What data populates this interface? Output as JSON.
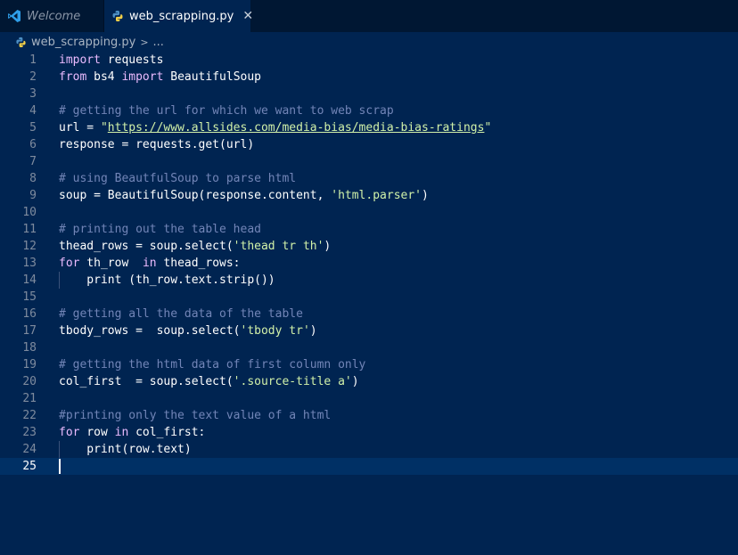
{
  "tabs": [
    {
      "label": "Welcome",
      "icon": "vscode-icon",
      "active": false
    },
    {
      "label": "web_scrapping.py",
      "icon": "python-icon",
      "active": true,
      "close": "✕"
    }
  ],
  "breadcrumb": {
    "file": "web_scrapping.py",
    "separator": ">",
    "more": "..."
  },
  "colors": {
    "editor_bg": "#002451",
    "tab_bar_bg": "#001733",
    "keyword": "#ebbbff",
    "comment": "#7285b7",
    "string": "#d1f1a9",
    "line_highlight": "#003065"
  },
  "editor": {
    "current_line": 25,
    "lines": [
      {
        "num": "1",
        "tokens": [
          {
            "t": "kw",
            "v": "import"
          },
          {
            "t": "id",
            "v": " requests"
          }
        ]
      },
      {
        "num": "2",
        "tokens": [
          {
            "t": "kw",
            "v": "from"
          },
          {
            "t": "id",
            "v": " bs4 "
          },
          {
            "t": "kw",
            "v": "import"
          },
          {
            "t": "id",
            "v": " BeautifulSoup"
          }
        ]
      },
      {
        "num": "3",
        "tokens": []
      },
      {
        "num": "4",
        "tokens": [
          {
            "t": "cm",
            "v": "# getting the url for which we want to web scrap"
          }
        ]
      },
      {
        "num": "5",
        "tokens": [
          {
            "t": "id",
            "v": "url = "
          },
          {
            "t": "st",
            "v": "\""
          },
          {
            "t": "url",
            "v": "https://www.allsides.com/media-bias/media-bias-ratings"
          },
          {
            "t": "st",
            "v": "\""
          }
        ]
      },
      {
        "num": "6",
        "tokens": [
          {
            "t": "id",
            "v": "response = requests.get(url)"
          }
        ]
      },
      {
        "num": "7",
        "tokens": []
      },
      {
        "num": "8",
        "tokens": [
          {
            "t": "cm",
            "v": "# using BeautfulSoup to parse html"
          }
        ]
      },
      {
        "num": "9",
        "tokens": [
          {
            "t": "id",
            "v": "soup = BeautifulSoup(response.content, "
          },
          {
            "t": "st",
            "v": "'html.parser'"
          },
          {
            "t": "id",
            "v": ")"
          }
        ]
      },
      {
        "num": "10",
        "tokens": []
      },
      {
        "num": "11",
        "tokens": [
          {
            "t": "cm",
            "v": "# printing out the table head"
          }
        ]
      },
      {
        "num": "12",
        "tokens": [
          {
            "t": "id",
            "v": "thead_rows = soup.select("
          },
          {
            "t": "st",
            "v": "'thead tr th'"
          },
          {
            "t": "id",
            "v": ")"
          }
        ]
      },
      {
        "num": "13",
        "tokens": [
          {
            "t": "kw",
            "v": "for"
          },
          {
            "t": "id",
            "v": " th_row  "
          },
          {
            "t": "kw",
            "v": "in"
          },
          {
            "t": "id",
            "v": " thead_rows:"
          }
        ]
      },
      {
        "num": "14",
        "indent": true,
        "tokens": [
          {
            "t": "id",
            "v": "    print (th_row.text.strip())"
          }
        ]
      },
      {
        "num": "15",
        "tokens": []
      },
      {
        "num": "16",
        "tokens": [
          {
            "t": "cm",
            "v": "# getting all the data of the table"
          }
        ]
      },
      {
        "num": "17",
        "tokens": [
          {
            "t": "id",
            "v": "tbody_rows =  soup.select("
          },
          {
            "t": "st",
            "v": "'tbody tr'"
          },
          {
            "t": "id",
            "v": ")"
          }
        ]
      },
      {
        "num": "18",
        "tokens": []
      },
      {
        "num": "19",
        "tokens": [
          {
            "t": "cm",
            "v": "# getting the html data of first column only"
          }
        ]
      },
      {
        "num": "20",
        "tokens": [
          {
            "t": "id",
            "v": "col_first  = soup.select("
          },
          {
            "t": "st",
            "v": "'.source-title a'"
          },
          {
            "t": "id",
            "v": ")"
          }
        ]
      },
      {
        "num": "21",
        "tokens": []
      },
      {
        "num": "22",
        "tokens": [
          {
            "t": "cm",
            "v": "#printing only the text value of a html"
          }
        ]
      },
      {
        "num": "23",
        "tokens": [
          {
            "t": "kw",
            "v": "for"
          },
          {
            "t": "id",
            "v": " row "
          },
          {
            "t": "kw",
            "v": "in"
          },
          {
            "t": "id",
            "v": " col_first:"
          }
        ]
      },
      {
        "num": "24",
        "indent": true,
        "tokens": [
          {
            "t": "id",
            "v": "    print(row.text)"
          }
        ]
      },
      {
        "num": "25",
        "tokens": []
      }
    ]
  }
}
